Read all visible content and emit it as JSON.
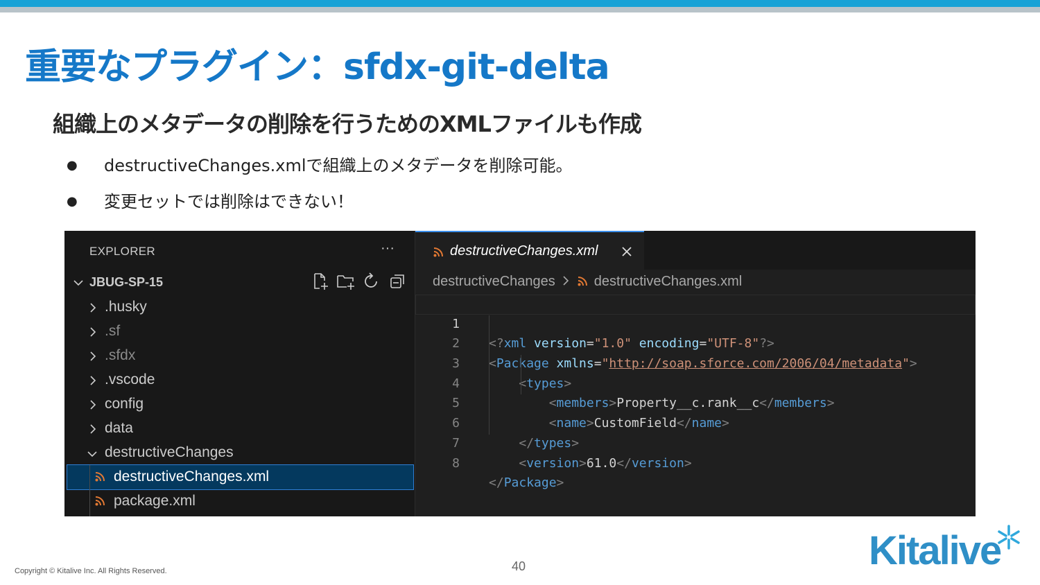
{
  "slide": {
    "title": "重要なプラグイン：sfdx-git-delta",
    "subtitle": "組織上のメタデータの削除を行うためのXMLファイルも作成",
    "bullets": [
      "destructiveChanges.xmlで組織上のメタデータを削除可能。",
      "変更セットでは削除はできない！"
    ],
    "bullet_symbol": "●",
    "page_number": "40",
    "copyright": "Copyright © Kitalive Inc. All Rights Reserved.",
    "logo_text": "Kitalive"
  },
  "explorer": {
    "title": "EXPLORER",
    "more": "···",
    "project": "JBUG-SP-15",
    "items": [
      {
        "label": ".husky",
        "type": "folder",
        "expanded": false
      },
      {
        "label": ".sf",
        "type": "folder",
        "expanded": false,
        "dim": true
      },
      {
        "label": ".sfdx",
        "type": "folder",
        "expanded": false,
        "dim": true
      },
      {
        "label": ".vscode",
        "type": "folder",
        "expanded": false
      },
      {
        "label": "config",
        "type": "folder",
        "expanded": false
      },
      {
        "label": "data",
        "type": "folder",
        "expanded": false
      },
      {
        "label": "destructiveChanges",
        "type": "folder",
        "expanded": true
      },
      {
        "label": "destructiveChanges.xml",
        "type": "file",
        "selected": true
      },
      {
        "label": "package.xml",
        "type": "file"
      }
    ]
  },
  "editor": {
    "tab_label": "destructiveChanges.xml",
    "breadcrumb": [
      "destructiveChanges",
      "destructiveChanges.xml"
    ],
    "line_numbers": [
      "1",
      "2",
      "3",
      "4",
      "5",
      "6",
      "7",
      "8"
    ],
    "code": {
      "l1": {
        "open": "<?",
        "tag": "xml",
        "a1": "version",
        "eq": "=",
        "v1": "\"1.0\"",
        "a2": "encoding",
        "v2": "\"UTF-8\"",
        "close": "?>"
      },
      "l2": {
        "tag": "Package",
        "attr": "xmlns",
        "url": "http://soap.sforce.com/2006/04/metadata"
      },
      "l3": {
        "tag": "types"
      },
      "l4": {
        "tag": "members",
        "text": "Property__c.rank__c"
      },
      "l5": {
        "tag": "name",
        "text": "CustomField"
      },
      "l6": {
        "tag": "types"
      },
      "l7": {
        "tag": "version",
        "text": "61.0"
      },
      "l8": {
        "tag": "Package"
      }
    }
  },
  "colors": {
    "accent": "#1578c8",
    "top_bar": "#17a2d6",
    "editor_bg": "#1f1f1f",
    "selection": "#04395e",
    "xml_icon": "#e37933"
  },
  "icons": {
    "collapse": "chevron-down-icon",
    "expand": "chevron-right-icon",
    "new_file": "new-file-icon",
    "new_folder": "new-folder-icon",
    "refresh": "refresh-icon",
    "collapse_all": "collapse-all-icon",
    "xml_file": "rss-xml-icon",
    "close": "close-icon"
  }
}
